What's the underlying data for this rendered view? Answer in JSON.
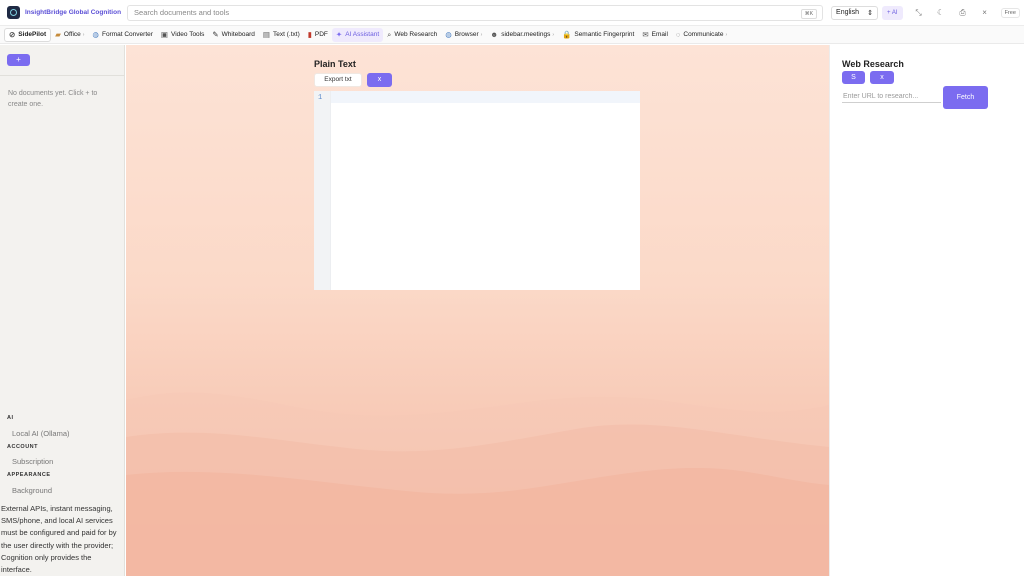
{
  "app": {
    "title": "InsightBridge Global Cognition"
  },
  "search": {
    "placeholder": "Search documents and tools",
    "shortcut": "⌘K"
  },
  "header": {
    "language": "English",
    "ai_label": "+ AI",
    "free_label": "Free"
  },
  "toolbar": {
    "items": [
      {
        "label": "SidePilot",
        "icon": "sidepilot-icon"
      },
      {
        "label": "Office",
        "icon": "folder-icon",
        "has_menu": true
      },
      {
        "label": "Format Converter",
        "icon": "globe-icon"
      },
      {
        "label": "Video Tools",
        "icon": "clapper-icon"
      },
      {
        "label": "Whiteboard",
        "icon": "pencil-icon"
      },
      {
        "label": "Text (.txt)",
        "icon": "document-icon"
      },
      {
        "label": "PDF",
        "icon": "book-icon"
      },
      {
        "label": "AI Assistant",
        "icon": "sparkle-icon",
        "active": true
      },
      {
        "label": "Web Research",
        "icon": "magnifier-icon"
      },
      {
        "label": "Browser",
        "icon": "globe-icon",
        "has_menu": true
      },
      {
        "label": "sidebar.meetings",
        "icon": "people-icon",
        "has_menu": true
      },
      {
        "label": "Semantic Fingerprint",
        "icon": "lock-icon"
      },
      {
        "label": "Email",
        "icon": "envelope-icon"
      },
      {
        "label": "Communicate",
        "icon": "speech-bubble-icon",
        "has_menu": true
      }
    ]
  },
  "sidebar": {
    "add_label": "+",
    "empty_message": "No documents yet. Click + to create one.",
    "sections": [
      {
        "heading": "AI",
        "link": "Local AI (Ollama)"
      },
      {
        "heading": "ACCOUNT",
        "link": "Subscription"
      },
      {
        "heading": "APPEARANCE",
        "link": "Background"
      }
    ],
    "disclaimer": "External APIs, instant messaging, SMS/phone, and local AI services must be configured and paid for by the user directly with the provider; Cognition only provides the interface."
  },
  "editor": {
    "title": "Plain Text",
    "export_label": "Export txt",
    "close_label": "x",
    "line_number": "1",
    "content": ""
  },
  "research": {
    "title": "Web Research",
    "save_label": "S",
    "close_label": "x",
    "url_placeholder": "Enter URL to research...",
    "fetch_label": "Fetch"
  },
  "colors": {
    "accent": "#7b6cf0",
    "brand_text": "#5b4fd6",
    "sidebar_bg": "#f3f2ef",
    "backdrop_top": "#fde3d6",
    "backdrop_bottom": "#f4bba6"
  }
}
